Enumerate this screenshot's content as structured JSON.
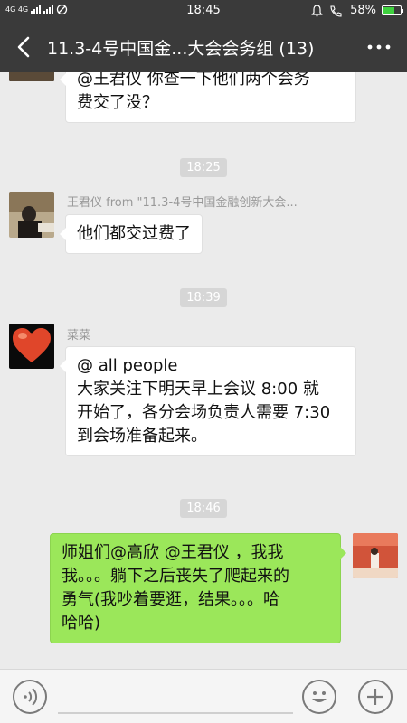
{
  "status_bar": {
    "network": "4G 4G",
    "time": "18:45",
    "battery": "58%",
    "battery_level": 0.58
  },
  "header": {
    "title": "11.3-4号中国金...大会会务组 (13)"
  },
  "messages": [
    {
      "type": "received",
      "text_lines": [
        "@王君仪  你查一下他们两个会务",
        "费交了没？"
      ]
    },
    {
      "type": "timestamp",
      "text": "18:25"
    },
    {
      "type": "received",
      "sender": "王君仪 from \"11.3-4号中国金融创新大会...",
      "text_lines": [
        "他们都交过费了"
      ]
    },
    {
      "type": "timestamp",
      "text": "18:39"
    },
    {
      "type": "received",
      "sender": "菜菜",
      "text_lines": [
        "@ all people",
        "大家关注下明天早上会议 8:00 就",
        "开始了，各分会场负责人需要 7:30",
        "到会场准备起来。"
      ]
    },
    {
      "type": "timestamp",
      "text": "18:46"
    },
    {
      "type": "sent",
      "text_lines": [
        "师姐们@高欣 @王君仪 ，我我",
        "我。。。躺下之后丧失了爬起来的",
        "勇气(我吵着要逛，结果。。。哈",
        "哈哈)"
      ]
    }
  ],
  "colors": {
    "header_bg": "#3a3a3a",
    "chat_bg": "#ebebeb",
    "sent_bubble": "#9be75a",
    "received_bubble": "#ffffff"
  }
}
